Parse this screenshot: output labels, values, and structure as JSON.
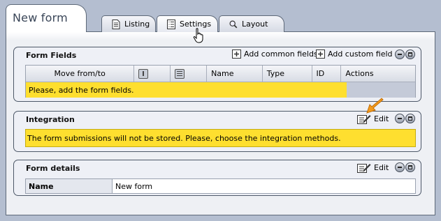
{
  "form": {
    "title": "New form"
  },
  "tabs": [
    {
      "label": "Listing",
      "icon": "document-icon"
    },
    {
      "label": "Settings",
      "icon": "list-icon",
      "active": true
    },
    {
      "label": "Layout",
      "icon": "magnifier-icon"
    }
  ],
  "form_fields": {
    "title": "Form Fields",
    "add_common_label": "Add common fields",
    "add_custom_label": "Add custom field",
    "columns": [
      "Move from/to",
      "",
      "",
      "Name",
      "Type",
      "ID",
      "Actions"
    ],
    "empty_message": "Please, add the form fields."
  },
  "integration": {
    "title": "Integration",
    "edit_label": "Edit",
    "notice": "The form submissions will not be stored. Please, choose the integration methods."
  },
  "form_details": {
    "title": "Form details",
    "edit_label": "Edit",
    "rows": [
      {
        "label": "Name",
        "value": "New form"
      }
    ]
  },
  "colors": {
    "background": "#b4bed0",
    "highlight": "#fedf2f",
    "panel": "#eef0f6",
    "arrow": "#f39a1c"
  }
}
